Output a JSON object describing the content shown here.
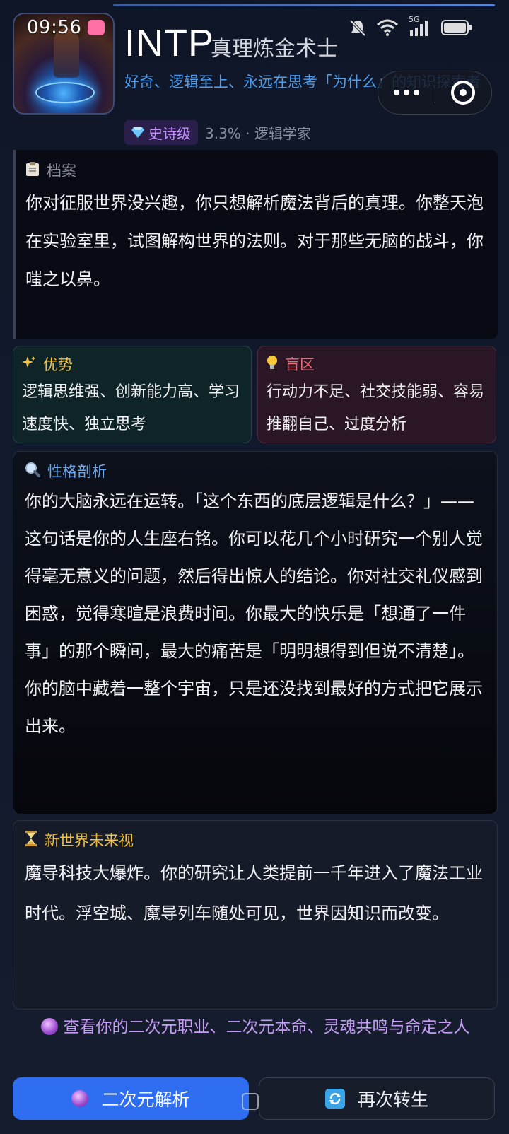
{
  "status_bar": {
    "time": "09:56",
    "app_badge": "bilibili",
    "icons": [
      "mute-icon",
      "wifi-icon",
      "signal-5g-icon",
      "battery-icon"
    ],
    "network_label": "5G"
  },
  "header": {
    "type_code": "INTP",
    "type_title": "真理炼金术士",
    "tagline": "好奇、逻辑至上、永远在思考「为什么」的知识探索者",
    "rarity_label": "史诗级",
    "rarity_icon": "diamond-icon",
    "rarity_meta": "3.3% · 逻辑学家"
  },
  "mini_program_capsule": {
    "more_icon": "more-dots-icon",
    "close_icon": "close-circle-icon"
  },
  "dossier": {
    "icon": "clipboard-icon",
    "heading": "档案",
    "body": "你对征服世界没兴趣，你只想解析魔法背后的真理。你整天泡在实验室里，试图解构世界的法则。对于那些无脑的战斗，你嗤之以鼻。"
  },
  "strengths": {
    "icon": "sparkles-icon",
    "heading": "优势",
    "body": "逻辑思维强、创新能力高、学习速度快、独立思考"
  },
  "blind_spots": {
    "icon": "lightbulb-icon",
    "heading": "盲区",
    "body": "行动力不足、社交技能弱、容易推翻自己、过度分析"
  },
  "analysis": {
    "icon": "magnifier-icon",
    "heading": "性格剖析",
    "body": "你的大脑永远在运转。「这个东西的底层逻辑是什么？」——这句话是你的人生座右铭。你可以花几个小时研究一个别人觉得毫无意义的问题，然后得出惊人的结论。你对社交礼仪感到困惑，觉得寒暄是浪费时间。你最大的快乐是「想通了一件事」的那个瞬间，最大的痛苦是「明明想得到但说不清楚」。你的脑中藏着一整个宇宙，只是还没找到最好的方式把它展示出来。"
  },
  "future": {
    "icon": "hourglass-icon",
    "heading": "新世界未来视",
    "body": "魔导科技大爆炸。你的研究让人类提前一千年进入了魔法工业时代。浮空城、魔导列车随处可见，世界因知识而改变。"
  },
  "more_link": {
    "icon": "crystal-ball-icon",
    "text": "查看你的二次元职业、二次元本命、灵魂共鸣与命定之人"
  },
  "actions": {
    "primary_label": "二次元解析",
    "primary_icon": "crystal-ball-icon",
    "secondary_label": "再次转生",
    "secondary_icon": "refresh-icon"
  },
  "colors": {
    "accent_blue": "#2f6ef0",
    "tagline_blue": "#4b9ef0",
    "epic_purple": "#c491ff",
    "strength_gold": "#f3c24a",
    "blind_red": "#ef6a72"
  }
}
